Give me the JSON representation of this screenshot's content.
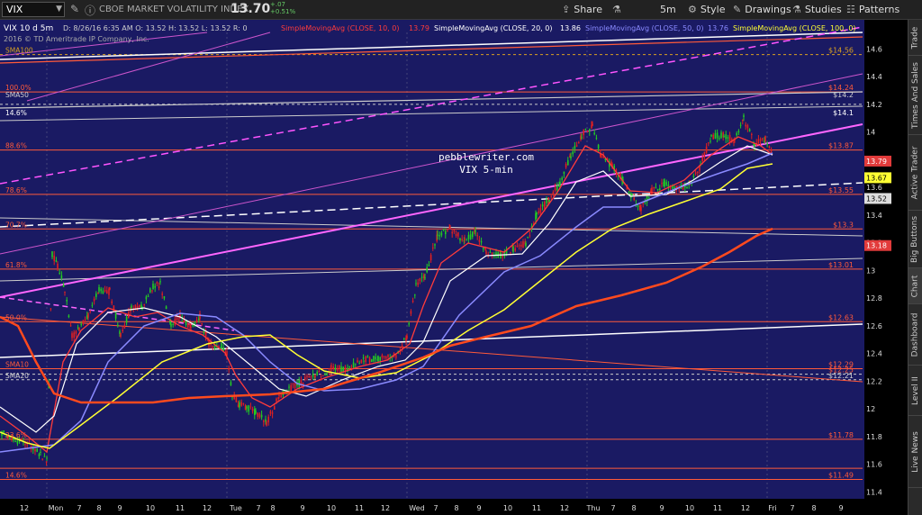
{
  "toolbar": {
    "symbol": "VIX",
    "description": "CBOE MARKET VOLATILITY INDEX",
    "last_price": "13.70",
    "change": "+.07",
    "change_pct": "+0.51%",
    "buttons": [
      {
        "label": "Share",
        "icon": "share-icon"
      },
      {
        "label": "",
        "icon": "flask-icon"
      },
      {
        "label": "5m",
        "icon": ""
      },
      {
        "label": "Style",
        "icon": "style-icon"
      },
      {
        "label": "Drawings",
        "icon": "drawings-icon"
      },
      {
        "label": "Studies",
        "icon": "studies-icon"
      },
      {
        "label": "Patterns",
        "icon": "patterns-icon"
      }
    ]
  },
  "chart": {
    "header": "VIX 10 d 5m",
    "ohlc": "D: 8/26/16 6:35 AM  O: 13.52  H: 13.52  L: 13.52  R: 0",
    "copyright": "2016 © TD Ameritrade IP Company, Inc.",
    "studies": [
      {
        "label": "SimpleMovingAvg (CLOSE, 10, 0)",
        "value": "13.79",
        "color": "#ff3b3b"
      },
      {
        "label": "SimpleMovingAvg (CLOSE, 20, 0)",
        "value": "13.86",
        "color": "#ffffff"
      },
      {
        "label": "SimpleMovingAvg (CLOSE, 50, 0)",
        "value": "13.76",
        "color": "#8a8aff"
      },
      {
        "label": "SimpleMovingAvg (CLOSE, 100, 0)",
        "value": "",
        "color": "#ffff33"
      }
    ],
    "watermark_site": "pebblewriter.com",
    "watermark_sub": "VIX 5-min",
    "left_labels": [
      {
        "text": "SMA100",
        "price": 14.56,
        "color": "#d9a020"
      },
      {
        "text": "100.0%",
        "price": 14.29,
        "color": "#ff5a3a"
      },
      {
        "text": "SMA50",
        "price": 14.24,
        "color": "#d0d0d0"
      },
      {
        "text": "14.6%",
        "price": 14.11,
        "color": "#ffffff"
      },
      {
        "text": "88.6%",
        "price": 13.87,
        "color": "#ff5a3a"
      },
      {
        "text": "78.6%",
        "price": 13.55,
        "color": "#ff5a3a"
      },
      {
        "text": "70.7%",
        "price": 13.3,
        "color": "#ff5a3a"
      },
      {
        "text": "61.8%",
        "price": 13.01,
        "color": "#ff5a3a"
      },
      {
        "text": "50.0%",
        "price": 12.63,
        "color": "#ff5a3a"
      },
      {
        "text": "SMA10",
        "price": 12.29,
        "color": "#ff5a3a"
      },
      {
        "text": "SMA20",
        "price": 12.21,
        "color": "#d0d0d0"
      },
      {
        "text": "23.6%",
        "price": 11.78,
        "color": "#ff5a3a"
      },
      {
        "text": "14.6%",
        "price": 11.49,
        "color": "#ff5a3a"
      }
    ],
    "right_levels": [
      {
        "text": "$14.56",
        "price": 14.56,
        "color": "#d9a020"
      },
      {
        "text": "$14.24",
        "price": 14.29,
        "color": "#ff5a3a"
      },
      {
        "text": "$14.2",
        "price": 14.24,
        "color": "#d0d0d0"
      },
      {
        "text": "$14.1",
        "price": 14.11,
        "color": "#ffffff"
      },
      {
        "text": "$13.87",
        "price": 13.87,
        "color": "#ff5a3a"
      },
      {
        "text": "$13.55",
        "price": 13.55,
        "color": "#ff5a3a"
      },
      {
        "text": "$13.3",
        "price": 13.3,
        "color": "#ff5a3a"
      },
      {
        "text": "$13.01",
        "price": 13.01,
        "color": "#ff5a3a"
      },
      {
        "text": "$12.63",
        "price": 12.63,
        "color": "#ff5a3a"
      },
      {
        "text": "$12.29",
        "price": 12.29,
        "color": "#ff5a3a"
      },
      {
        "text": "$12.25",
        "price": 12.25,
        "color": "#ff5a3a"
      },
      {
        "text": "$12.21",
        "price": 12.21,
        "color": "#d0d0d0"
      },
      {
        "text": "$11.78",
        "price": 11.78,
        "color": "#ff5a3a"
      },
      {
        "text": "$11.49",
        "price": 11.49,
        "color": "#ff5a3a"
      }
    ],
    "price_tags": [
      {
        "text": "13.79",
        "price": 13.79,
        "bg": "#e23b3b",
        "fg": "#ffffff"
      },
      {
        "text": "13.67",
        "price": 13.67,
        "bg": "#ffff33",
        "fg": "#000000"
      },
      {
        "text": "13.6",
        "price": 13.6,
        "bg": "",
        "fg": "#dddddd"
      },
      {
        "text": "13.52",
        "price": 13.52,
        "bg": "#dddddd",
        "fg": "#000000"
      },
      {
        "text": "13.18",
        "price": 13.18,
        "bg": "#e23b3b",
        "fg": "#ffffff"
      }
    ],
    "y_ticks": [
      "14.6",
      "14.4",
      "14.2",
      "14",
      "13.8",
      "13.4",
      "13.2",
      "13",
      "12.8",
      "12.6",
      "12.4",
      "12.2",
      "12",
      "11.8",
      "11.6",
      "11.4"
    ],
    "x_ticks": [
      "12",
      "Mon",
      "7",
      "8",
      "9",
      "10",
      "11",
      "12",
      "Tue",
      "7",
      "8",
      "9",
      "10",
      "11",
      "12",
      "Wed",
      "7",
      "8",
      "9",
      "10",
      "11",
      "12",
      "Thu",
      "7",
      "8",
      "9",
      "10",
      "11",
      "12",
      "Fri",
      "7",
      "8",
      "9"
    ]
  },
  "side_tabs": [
    "Trade",
    "Times And Sales",
    "Active Trader",
    "Big Buttons",
    "Chart",
    "Dashboard",
    "Level II",
    "Live News"
  ],
  "side_active": "Chart"
}
